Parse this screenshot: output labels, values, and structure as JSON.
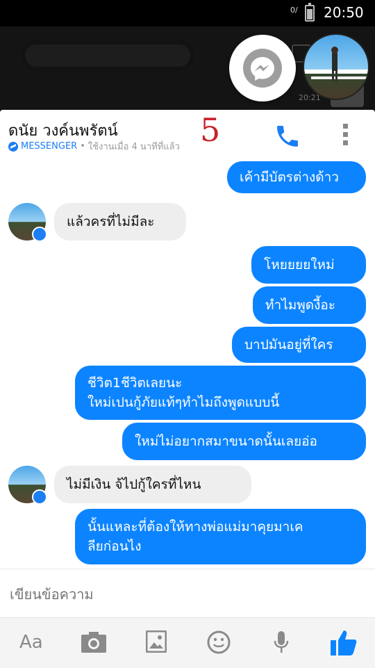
{
  "status_bar": {
    "signal": "0/",
    "time": "20:50"
  },
  "background": {
    "time_fragment": "20:21"
  },
  "conversation": {
    "contact_name": "ดนัย วงค์นพรัตน์",
    "app_label": "MESSENGER",
    "separator": "•",
    "active_status": "ใช้งานเมื่อ 4 นาทีที่แล้ว",
    "annotation_number": "5"
  },
  "messages": [
    {
      "dir": "out",
      "text": "เค้ามีบัตรต่างด้าว"
    },
    {
      "dir": "in",
      "text": "แล้วครที่ไม่มีละ"
    },
    {
      "dir": "out",
      "text": "โหยยยยใหม่"
    },
    {
      "dir": "out",
      "text": "ทำไมพูดงี้อะ"
    },
    {
      "dir": "out",
      "text": "บาปมันอยู่ที่ใคร"
    },
    {
      "dir": "out",
      "text": "ชีวิต1ชีวิตเลยนะ\nใหม่เปนกู้ภัยแท้ๆทำไมถึงพูดแบบนี้"
    },
    {
      "dir": "out",
      "text": "ใหม่ไม่อยากสมาขนาดนั้นเลยอ่อ"
    },
    {
      "dir": "in",
      "text": "ไม่มีเงิน จ้ไปกู้ใครที่ไหน"
    },
    {
      "dir": "out",
      "text": "นั้นแหละที่ต้องให้ทางพ่อแม่มาคุยมาเค\nลียก่อนไง"
    }
  ],
  "composer": {
    "placeholder": "เขียนข้อความ"
  },
  "toolbar": {
    "text_label": "Aa"
  },
  "icons": [
    "messenger-icon",
    "phone-icon",
    "more-vertical-icon",
    "camera-icon",
    "image-icon",
    "emoji-icon",
    "microphone-icon",
    "thumbs-up-icon"
  ],
  "colors": {
    "accent": "#0d84ff",
    "incoming_bubble": "#eeeeee",
    "annotation": "#c8232c"
  }
}
